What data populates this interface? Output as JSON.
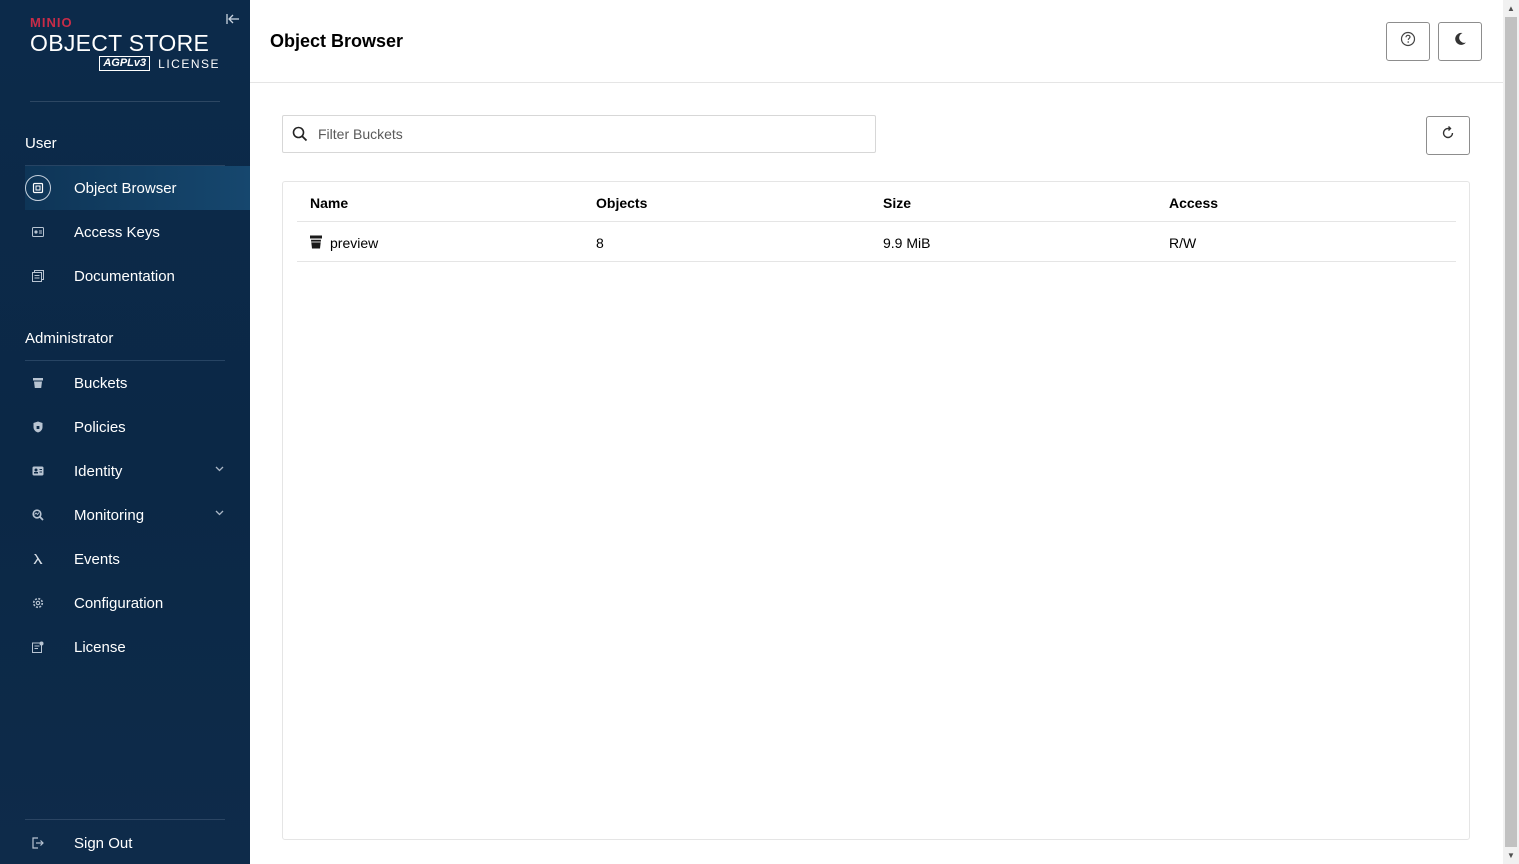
{
  "sidebar": {
    "logo": {
      "brand": "MINIO",
      "title": "OBJECT STORE",
      "badge": "AGPLv3",
      "license": "LICENSE"
    },
    "collapse_icon": "collapse-left-icon",
    "sections": {
      "user": "User",
      "admin": "Administrator"
    },
    "items": [
      {
        "label": "Object Browser",
        "icon": "object-browser-icon",
        "active": true
      },
      {
        "label": "Access Keys",
        "icon": "access-keys-icon"
      },
      {
        "label": "Documentation",
        "icon": "documentation-icon"
      },
      {
        "label": "Buckets",
        "icon": "bucket-icon"
      },
      {
        "label": "Policies",
        "icon": "shield-icon"
      },
      {
        "label": "Identity",
        "icon": "identity-icon",
        "expandable": true
      },
      {
        "label": "Monitoring",
        "icon": "monitoring-icon",
        "expandable": true
      },
      {
        "label": "Events",
        "icon": "lambda-icon"
      },
      {
        "label": "Configuration",
        "icon": "gear-icon"
      },
      {
        "label": "License",
        "icon": "license-icon"
      }
    ],
    "sign_out": {
      "label": "Sign Out",
      "icon": "sign-out-icon"
    }
  },
  "header": {
    "title": "Object Browser",
    "help_icon": "help-icon",
    "theme_icon": "moon-icon"
  },
  "search": {
    "placeholder": "Filter Buckets",
    "value": ""
  },
  "table": {
    "columns": [
      "Name",
      "Objects",
      "Size",
      "Access"
    ],
    "rows": [
      {
        "name": "preview",
        "objects": "8",
        "size": "9.9 MiB",
        "access": "R/W"
      }
    ]
  },
  "colors": {
    "sidebar_bg": "#0c2a4a",
    "brand_red": "#c72c48",
    "active_item": "#16476e"
  }
}
